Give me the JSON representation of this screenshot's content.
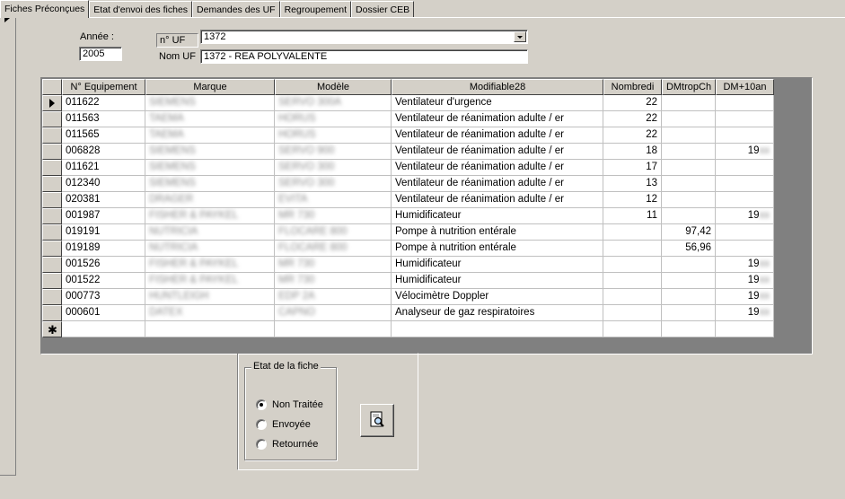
{
  "tabs": [
    {
      "label": "Fiches Préconçues",
      "active": true
    },
    {
      "label": "Etat d'envoi des fiches",
      "active": false
    },
    {
      "label": "Demandes des UF",
      "active": false
    },
    {
      "label": "Regroupement",
      "active": false
    },
    {
      "label": "Dossier CEB",
      "active": false
    }
  ],
  "form": {
    "annee_label": "Année :",
    "annee_value": "2005",
    "uf_label": "n° UF",
    "uf_value": "1372",
    "nom_uf_label": "Nom UF",
    "nom_uf_value": "1372 - REA POLYVALENTE"
  },
  "grid": {
    "columns": [
      "N° Equipement",
      "Marque",
      "Modèle",
      "Modifiable28",
      "Nombredi",
      "DMtropCh",
      "DM+10an"
    ],
    "rows": [
      {
        "equip": "011622",
        "marque": "SIEMENS",
        "modele": "SERVO 300A",
        "modif": "Ventilateur d'urgence",
        "nombre": "22",
        "dmtrop": "",
        "dm10": ""
      },
      {
        "equip": "011563",
        "marque": "TAEMA",
        "modele": "HORUS",
        "modif": "Ventilateur de réanimation adulte / er",
        "nombre": "22",
        "dmtrop": "",
        "dm10": ""
      },
      {
        "equip": "011565",
        "marque": "TAEMA",
        "modele": "HORUS",
        "modif": "Ventilateur de réanimation adulte / er",
        "nombre": "22",
        "dmtrop": "",
        "dm10": ""
      },
      {
        "equip": "006828",
        "marque": "SIEMENS",
        "modele": "SERVO 900",
        "modif": "Ventilateur de réanimation adulte / er",
        "nombre": "18",
        "dmtrop": "",
        "dm10": "19xx"
      },
      {
        "equip": "011621",
        "marque": "SIEMENS",
        "modele": "SERVO 300",
        "modif": "Ventilateur de réanimation adulte / er",
        "nombre": "17",
        "dmtrop": "",
        "dm10": ""
      },
      {
        "equip": "012340",
        "marque": "SIEMENS",
        "modele": "SERVO 300",
        "modif": "Ventilateur de réanimation adulte / er",
        "nombre": "13",
        "dmtrop": "",
        "dm10": ""
      },
      {
        "equip": "020381",
        "marque": "DRAGER",
        "modele": "EVITA",
        "modif": "Ventilateur de réanimation adulte / er",
        "nombre": "12",
        "dmtrop": "",
        "dm10": ""
      },
      {
        "equip": "001987",
        "marque": "FISHER & PAYKEL",
        "modele": "MR 730",
        "modif": "Humidificateur",
        "nombre": "11",
        "dmtrop": "",
        "dm10": "19xx"
      },
      {
        "equip": "019191",
        "marque": "NUTRICIA",
        "modele": "FLOCARE 800",
        "modif": "Pompe à nutrition entérale",
        "nombre": "",
        "dmtrop": "97,42",
        "dm10": ""
      },
      {
        "equip": "019189",
        "marque": "NUTRICIA",
        "modele": "FLOCARE 800",
        "modif": "Pompe à nutrition entérale",
        "nombre": "",
        "dmtrop": "56,96",
        "dm10": ""
      },
      {
        "equip": "001526",
        "marque": "FISHER & PAYKEL",
        "modele": "MR 730",
        "modif": "Humidificateur",
        "nombre": "",
        "dmtrop": "",
        "dm10": "19xx"
      },
      {
        "equip": "001522",
        "marque": "FISHER & PAYKEL",
        "modele": "MR 730",
        "modif": "Humidificateur",
        "nombre": "",
        "dmtrop": "",
        "dm10": "19xx"
      },
      {
        "equip": "000773",
        "marque": "HUNTLEIGH",
        "modele": "EDP 2A",
        "modif": "Vélocimètre Doppler",
        "nombre": "",
        "dmtrop": "",
        "dm10": "19xx"
      },
      {
        "equip": "000601",
        "marque": "DATEX",
        "modele": "CAPNO",
        "modif": "Analyseur de gaz respiratoires",
        "nombre": "",
        "dmtrop": "",
        "dm10": "19xx"
      }
    ]
  },
  "etat": {
    "title": "Etat de la fiche",
    "options": [
      {
        "label": "Non Traitée",
        "checked": true
      },
      {
        "label": "Envoyée",
        "checked": false
      },
      {
        "label": "Retournée",
        "checked": false
      }
    ]
  },
  "icons": {
    "preview": "print-preview-icon",
    "record_selector": "record-pointer-icon",
    "new_record": "new-record-star-icon"
  }
}
